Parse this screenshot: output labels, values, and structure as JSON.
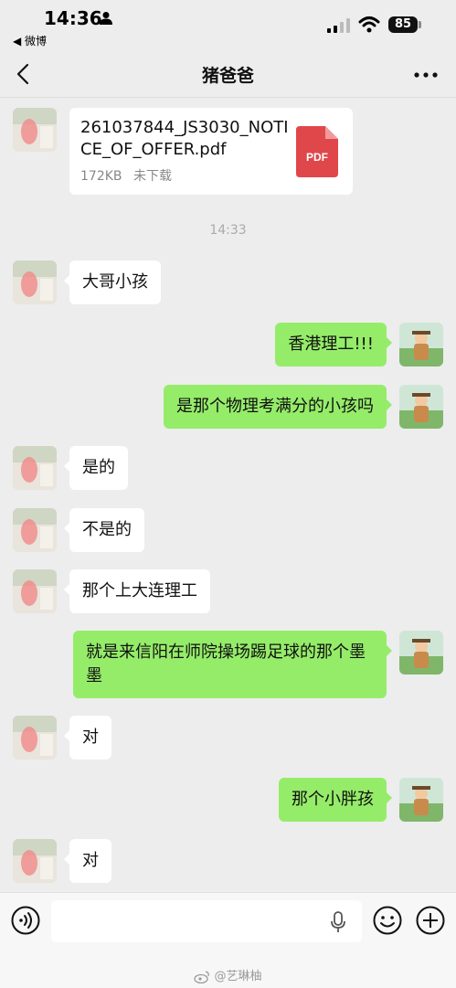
{
  "status_bar": {
    "time": "14:36",
    "back_app": "◀ 微博",
    "battery": "85"
  },
  "nav": {
    "title": "猪爸爸"
  },
  "file": {
    "name": "261037844_JS3030_NOTICE_OF_OFFER.pdf",
    "size": "172KB",
    "status": "未下载",
    "icon_label": "PDF"
  },
  "timestamp": "14:33",
  "messages": [
    {
      "side": "in",
      "text": "大哥小孩"
    },
    {
      "side": "out",
      "text": "香港理工!!!"
    },
    {
      "side": "out",
      "text": "是那个物理考满分的小孩吗"
    },
    {
      "side": "in",
      "text": "是的"
    },
    {
      "side": "in",
      "text": "不是的"
    },
    {
      "side": "in",
      "text": "那个上大连理工"
    },
    {
      "side": "out",
      "text": "就是来信阳在师院操场踢足球的那个墨墨"
    },
    {
      "side": "in",
      "text": "对"
    },
    {
      "side": "out",
      "text": "那个小胖孩"
    },
    {
      "side": "in",
      "text": "对"
    }
  ],
  "input": {
    "placeholder": ""
  },
  "watermark": "@艺琳柚",
  "colors": {
    "outgoing_bubble": "#95ec69",
    "incoming_bubble": "#ffffff",
    "background": "#ededed",
    "pdf_red": "#e0474a"
  }
}
